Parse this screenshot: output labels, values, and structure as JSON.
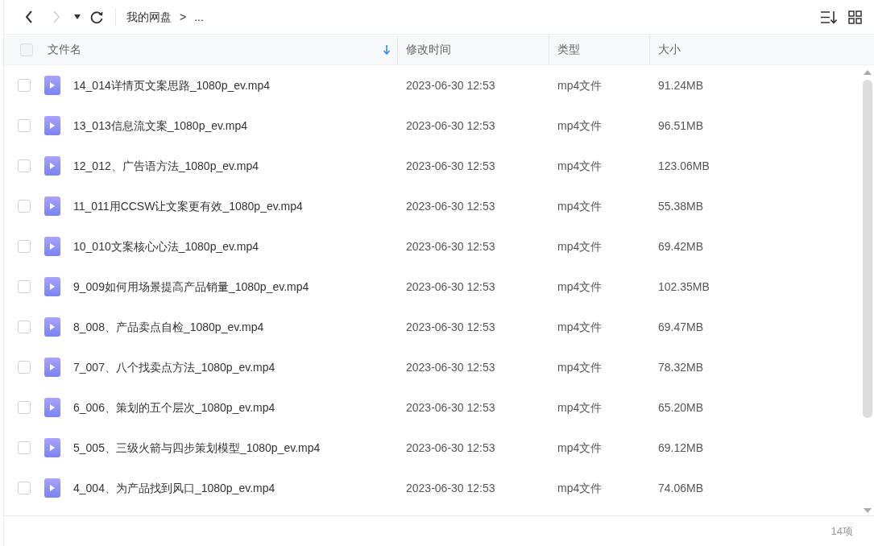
{
  "toolbar": {
    "breadcrumb": [
      {
        "label": "我的网盘"
      },
      {
        "label": "..."
      }
    ],
    "separator": ">"
  },
  "table": {
    "select_all": {
      "checked": false
    },
    "columns": [
      {
        "label": "文件名",
        "sorted": true
      },
      {
        "label": "修改时间",
        "sorted": false
      },
      {
        "label": "类型",
        "sorted": false
      },
      {
        "label": "大小",
        "sorted": false
      }
    ],
    "rows": [
      {
        "name": "14_014详情页文案思路_1080p_ev.mp4",
        "modified": "2023-06-30 12:53",
        "type": "mp4文件",
        "size": "91.24MB",
        "checked": false
      },
      {
        "name": "13_013信息流文案_1080p_ev.mp4",
        "modified": "2023-06-30 12:53",
        "type": "mp4文件",
        "size": "96.51MB",
        "checked": false
      },
      {
        "name": "12_012、广告语方法_1080p_ev.mp4",
        "modified": "2023-06-30 12:53",
        "type": "mp4文件",
        "size": "123.06MB",
        "checked": false
      },
      {
        "name": "11_011用CCSW让文案更有效_1080p_ev.mp4",
        "modified": "2023-06-30 12:53",
        "type": "mp4文件",
        "size": "55.38MB",
        "checked": false
      },
      {
        "name": "10_010文案核心心法_1080p_ev.mp4",
        "modified": "2023-06-30 12:53",
        "type": "mp4文件",
        "size": "69.42MB",
        "checked": false
      },
      {
        "name": "9_009如何用场景提高产品销量_1080p_ev.mp4",
        "modified": "2023-06-30 12:53",
        "type": "mp4文件",
        "size": "102.35MB",
        "checked": false
      },
      {
        "name": "8_008、产品卖点自检_1080p_ev.mp4",
        "modified": "2023-06-30 12:53",
        "type": "mp4文件",
        "size": "69.47MB",
        "checked": false
      },
      {
        "name": "7_007、八个找卖点方法_1080p_ev.mp4",
        "modified": "2023-06-30 12:53",
        "type": "mp4文件",
        "size": "78.32MB",
        "checked": false
      },
      {
        "name": "6_006、策划的五个层次_1080p_ev.mp4",
        "modified": "2023-06-30 12:53",
        "type": "mp4文件",
        "size": "65.20MB",
        "checked": false
      },
      {
        "name": "5_005、三级火箭与四步策划模型_1080p_ev.mp4",
        "modified": "2023-06-30 12:53",
        "type": "mp4文件",
        "size": "69.12MB",
        "checked": false
      },
      {
        "name": "4_004、为产品找到风口_1080p_ev.mp4",
        "modified": "2023-06-30 12:53",
        "type": "mp4文件",
        "size": "74.06MB",
        "checked": false
      }
    ]
  },
  "status_bar": {
    "count": "14项"
  }
}
